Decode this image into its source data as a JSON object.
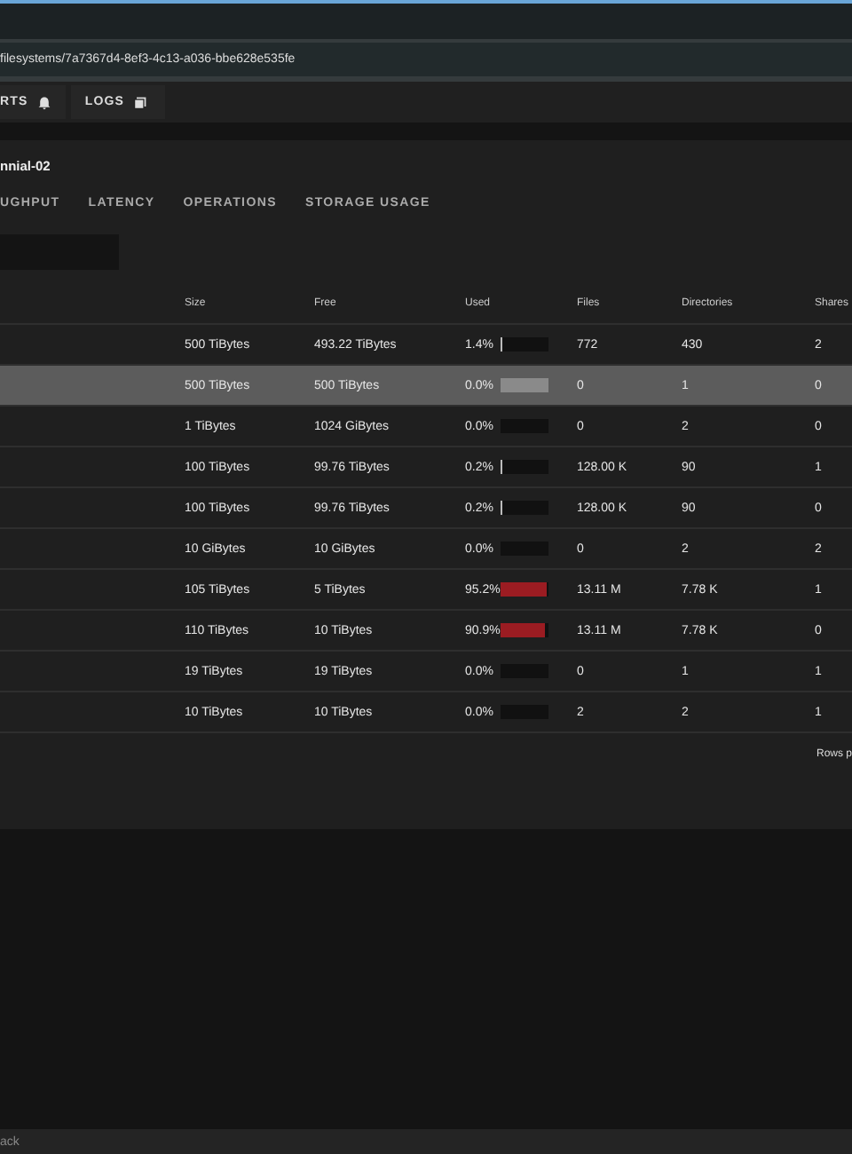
{
  "address_bar": {
    "url": "filesystems/7a7367d4-8ef3-4c13-a036-bbe628e535fe"
  },
  "toolbar": {
    "buttons": [
      {
        "label": "RTS"
      },
      {
        "label": "LOGS"
      }
    ]
  },
  "title": "nnial-02",
  "tabs": [
    {
      "label": "UGHPUT",
      "selected": false
    },
    {
      "label": "LATENCY",
      "selected": false
    },
    {
      "label": "OPERATIONS",
      "selected": false
    },
    {
      "label": "STORAGE USAGE",
      "selected": false
    }
  ],
  "table": {
    "columns": [
      "Size",
      "Free",
      "Used",
      "Files",
      "Directories",
      "Shares"
    ],
    "rows": [
      {
        "size": "500 TiBytes",
        "free": "493.22 TiBytes",
        "used": "1.4%",
        "level": 0.014,
        "files": "772",
        "directories": "430",
        "shares": "2",
        "selected": false
      },
      {
        "size": "500 TiBytes",
        "free": "500 TiBytes",
        "used": "0.0%",
        "files": "0",
        "directories": "1",
        "shares": "0",
        "selected": true
      },
      {
        "size": "1 TiBytes",
        "free": "1024 GiBytes",
        "used": "0.0%",
        "files": "0",
        "directories": "2",
        "shares": "0",
        "selected": false
      },
      {
        "size": "100 TiBytes",
        "free": "99.76 TiBytes",
        "used": "0.2%",
        "level": 0.002,
        "files": "128.00 K",
        "directories": "90",
        "shares": "1",
        "selected": false
      },
      {
        "size": "100 TiBytes",
        "free": "99.76 TiBytes",
        "used": "0.2%",
        "level": 0.002,
        "files": "128.00 K",
        "directories": "90",
        "shares": "0",
        "selected": false
      },
      {
        "size": "10 GiBytes",
        "free": "10 GiBytes",
        "used": "0.0%",
        "files": "0",
        "directories": "2",
        "shares": "2",
        "selected": false
      },
      {
        "size": "105 TiBytes",
        "free": "5 TiBytes",
        "used": "95.2%",
        "level": 0.952,
        "files": "13.11 M",
        "directories": "7.78 K",
        "shares": "1",
        "selected": false
      },
      {
        "size": "110 TiBytes",
        "free": "10 TiBytes",
        "used": "90.9%",
        "level": 0.909,
        "files": "13.11 M",
        "directories": "7.78 K",
        "shares": "0",
        "selected": false
      },
      {
        "size": "19 TiBytes",
        "free": "19 TiBytes",
        "used": "0.0%",
        "files": "0",
        "directories": "1",
        "shares": "1",
        "selected": false
      },
      {
        "size": "10 TiBytes",
        "free": "10 TiBytes",
        "used": "0.0%",
        "files": "2",
        "directories": "2",
        "shares": "1",
        "selected": false
      }
    ],
    "footer": "Rows p"
  },
  "status_bar": {
    "text": "ack"
  }
}
